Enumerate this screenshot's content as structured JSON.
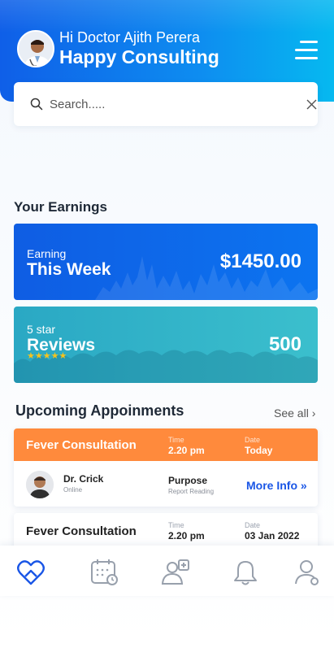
{
  "header": {
    "greeting": "Hi Doctor Ajith Perera",
    "title": "Happy Consulting"
  },
  "search": {
    "placeholder": "Search....."
  },
  "earnings": {
    "section_title": "Your Earnings",
    "earning_card": {
      "label_small": "Earning",
      "label_big": "This Week",
      "value": "$1450.00"
    },
    "reviews_card": {
      "label_small": "5 star",
      "label_big": "Reviews",
      "value": "500",
      "stars": "★★★★★"
    }
  },
  "upcoming": {
    "section_title": "Upcoming Appoinments",
    "see_all": "See all ›",
    "appointments": [
      {
        "name": "Fever Consultation",
        "time_label": "Time",
        "time": "2.20 pm",
        "date_label": "Date",
        "date": "Today",
        "doctor": "Dr. Crick",
        "doctor_status": "Online",
        "purpose": "Purpose",
        "purpose_detail": "Report Reading",
        "more_info": "More Info »"
      },
      {
        "name": "Fever Consultation",
        "time_label": "Time",
        "time": "2.20 pm",
        "date_label": "Date",
        "date": "03 Jan 2022"
      }
    ]
  },
  "nav": {
    "items": [
      "home-heart-icon",
      "calendar-icon",
      "patients-icon",
      "bell-icon",
      "profile-icon"
    ]
  },
  "colors": {
    "primary": "#0f5fe8",
    "accent_orange": "#ff8a3c",
    "teal": "#2aa8c4",
    "link": "#1a56e6"
  }
}
